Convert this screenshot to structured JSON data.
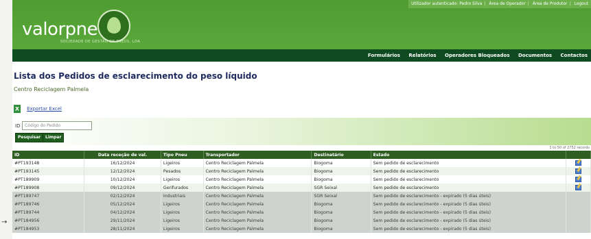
{
  "header": {
    "logo": "valorpneu",
    "logo_sub": "SOCIEDADE DE GESTÃO DE PNEUS, LDA",
    "toplinks": [
      "Utilizador autenticado: Pedro Silva",
      "Área de Operador",
      "Área de Produtor",
      "Logout"
    ]
  },
  "nav": [
    "Formulários",
    "Relatórios",
    "Operadores Bloqueados",
    "Documentos",
    "Contactos"
  ],
  "page": {
    "title": "Lista dos Pedidos de esclarecimento do peso líquido",
    "subtitle": "Centro Reciclagem Palmela",
    "export_label": "Exportar Excel"
  },
  "filter": {
    "label": "ID",
    "placeholder": "Código do Pedido",
    "search_button": "Pesquisar",
    "clear_button": "Limpar"
  },
  "pagination_text": "1 to 50 of 2752 records",
  "table": {
    "columns": [
      "ID",
      "Data receção de val.",
      "Tipo Pneu",
      "Transportador",
      "Destinatário",
      "Estado",
      ""
    ],
    "rows": [
      {
        "id": "#PT193148",
        "date": "16/12/2024",
        "type": "Ligeiros",
        "carrier": "Centro Reciclagem Palmela",
        "dest": "Biogoma",
        "status": "Sem pedido de esclarecimento",
        "edit": true
      },
      {
        "id": "#PT193145",
        "date": "12/12/2024",
        "type": "Pesados",
        "carrier": "Centro Reciclagem Palmela",
        "dest": "Biogoma",
        "status": "Sem pedido de esclarecimento",
        "edit": true
      },
      {
        "id": "#PT189909",
        "date": "10/12/2024",
        "type": "Ligeiros",
        "carrier": "Centro Reciclagem Palmela",
        "dest": "Biogoma",
        "status": "Sem pedido de esclarecimento",
        "edit": true
      },
      {
        "id": "#PT189908",
        "date": "09/12/2024",
        "type": "Gerifurados",
        "carrier": "Centro Reciclagem Palmela",
        "dest": "SGR Seixal",
        "status": "Sem pedido de esclarecimento",
        "edit": true
      },
      {
        "id": "#PT189747",
        "date": "02/12/2024",
        "type": "Industriais",
        "carrier": "Centro Reciclagem Palmela",
        "dest": "SGR Seixal",
        "status": "Sem pedido de esclarecimento - expirado (5 dias úteis)",
        "edit": false
      },
      {
        "id": "#PT189746",
        "date": "05/12/2024",
        "type": "Ligeiros",
        "carrier": "Centro Reciclagem Palmela",
        "dest": "Biogoma",
        "status": "Sem pedido de esclarecimento - expirado (5 dias úteis)",
        "edit": false
      },
      {
        "id": "#PT189744",
        "date": "04/12/2024",
        "type": "Ligeiros",
        "carrier": "Centro Reciclagem Palmela",
        "dest": "Biogoma",
        "status": "Sem pedido de esclarecimento - expirado (5 dias úteis)",
        "edit": false
      },
      {
        "id": "#PT184956",
        "date": "29/11/2024",
        "type": "Ligeiros",
        "carrier": "Centro Reciclagem Palmela",
        "dest": "Biogoma",
        "status": "Sem pedido de esclarecimento - expirado (5 dias úteis)",
        "edit": false
      },
      {
        "id": "#PT184953",
        "date": "28/11/2024",
        "type": "Ligeiros",
        "carrier": "Centro Reciclagem Palmela",
        "dest": "Biogoma",
        "status": "Sem pedido de esclarecimento - expirado (5 dias úteis)",
        "edit": false
      }
    ]
  },
  "colors": {
    "header_green": "#5aa83b",
    "nav_dark_green": "#0f4b20",
    "table_header": "#2f5e22",
    "expired_row": "#cfd3cf",
    "title_blue": "#1c2a5e"
  }
}
